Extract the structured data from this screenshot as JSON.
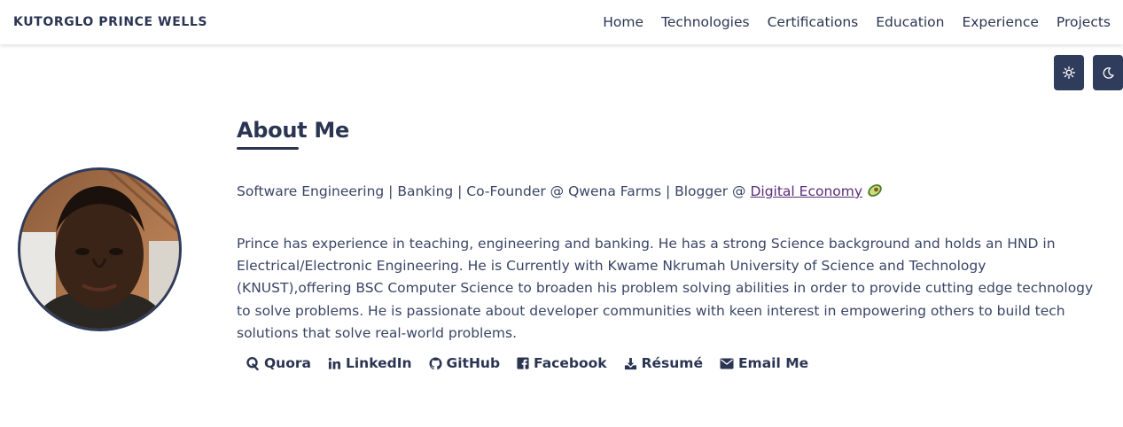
{
  "brand": "KUTORGLO PRINCE WELLS",
  "nav": [
    "Home",
    "Technologies",
    "Certifications",
    "Education",
    "Experience",
    "Projects"
  ],
  "theme_buttons": {
    "light_icon": "sun-icon",
    "dark_icon": "moon-icon"
  },
  "about": {
    "heading": "About Me",
    "tagline_prefix": "Software Engineering | Banking | Co-Founder @ Qwena Farms | Blogger @ ",
    "tagline_link": "Digital Economy",
    "bio": "Prince has experience in teaching, engineering and banking. He has a strong Science background and holds an HND in Electrical/Electronic Engineering. He is Currently with Kwame Nkrumah University of Science and Technology (KNUST),offering BSC Computer Science to broaden his problem solving abilities in order to provide cutting edge technology to solve problems. He is passionate about developer communities with keen interest in empowering others to build tech solutions that solve real-world problems."
  },
  "links": [
    {
      "label": "Quora",
      "icon": "quora-icon"
    },
    {
      "label": "LinkedIn",
      "icon": "linkedin-icon"
    },
    {
      "label": "GitHub",
      "icon": "github-icon"
    },
    {
      "label": "Facebook",
      "icon": "facebook-icon"
    },
    {
      "label": "Résumé",
      "icon": "download-icon"
    },
    {
      "label": "Email Me",
      "icon": "envelope-icon"
    }
  ],
  "colors": {
    "primary": "#2f3c5b",
    "link": "#5b2d7a"
  }
}
